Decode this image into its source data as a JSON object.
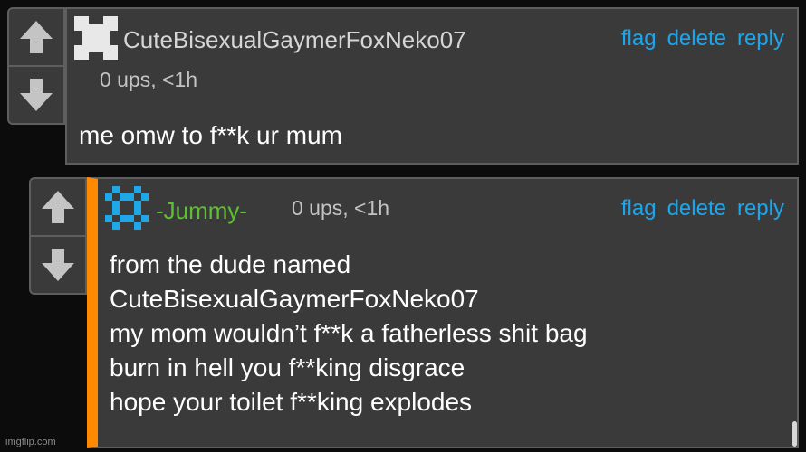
{
  "comments": [
    {
      "username": "CuteBisexualGaymerFoxNeko07",
      "username_color": "#d6d6d6",
      "avatar": "white-pixel-avatar-icon",
      "meta": "0 ups, <1h",
      "actions": {
        "flag": "flag",
        "delete": "delete",
        "reply": "reply"
      },
      "body": [
        "me omw to f**k ur mum"
      ]
    },
    {
      "username": "-Jummy-",
      "username_color": "#5cc032",
      "avatar": "blue-pixel-avatar-icon",
      "meta": "0 ups, <1h",
      "actions": {
        "flag": "flag",
        "delete": "delete",
        "reply": "reply"
      },
      "body": [
        "from the dude named",
        "CuteBisexualGaymerFoxNeko07",
        "my mom wouldn’t f**k a fatherless shit bag",
        "burn in hell you f**king disgrace",
        "hope your toilet f**king explodes"
      ]
    }
  ],
  "watermark": "imgflip.com",
  "colors": {
    "background": "#0c0c0c",
    "card": "#3a3a3a",
    "border": "#5e5e5e",
    "link": "#1aa7f0",
    "reply_accent": "#ff8a00",
    "vote_arrow": "#c4c4c4"
  }
}
